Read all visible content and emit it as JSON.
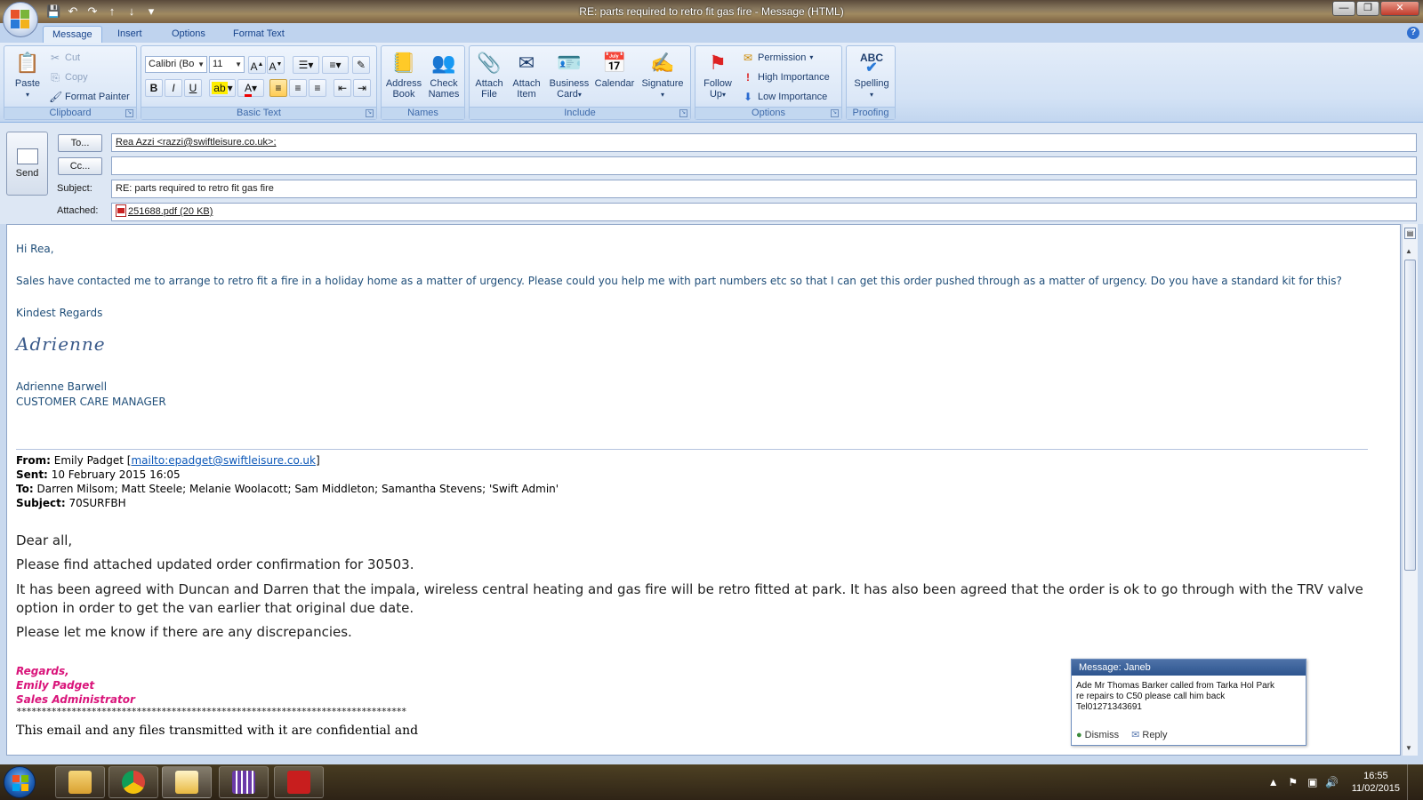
{
  "window": {
    "title": "RE: parts required to retro fit gas fire  - Message (HTML)",
    "controls": {
      "minimize": "—",
      "maximize": "❐",
      "close": "✕"
    }
  },
  "ribbon": {
    "tabs": [
      "Message",
      "Insert",
      "Options",
      "Format Text"
    ],
    "active_tab": "Message",
    "clipboard": {
      "label": "Clipboard",
      "paste": "Paste",
      "cut": "Cut",
      "copy": "Copy",
      "format_painter": "Format Painter"
    },
    "basic_text": {
      "label": "Basic Text",
      "font": "Calibri (Bo",
      "size": "11",
      "bold": "B",
      "italic": "I",
      "underline": "U"
    },
    "names": {
      "label": "Names",
      "address_book_1": "Address",
      "address_book_2": "Book",
      "check_names_1": "Check",
      "check_names_2": "Names"
    },
    "include": {
      "label": "Include",
      "attach_file_1": "Attach",
      "attach_file_2": "File",
      "attach_item_1": "Attach",
      "attach_item_2": "Item",
      "business_card_1": "Business",
      "business_card_2": "Card",
      "calendar": "Calendar",
      "signature": "Signature"
    },
    "options": {
      "label": "Options",
      "follow_up_1": "Follow",
      "follow_up_2": "Up",
      "permission": "Permission",
      "high_importance": "High Importance",
      "low_importance": "Low Importance"
    },
    "proofing": {
      "label": "Proofing",
      "spelling": "Spelling",
      "abc": "ABC"
    }
  },
  "header": {
    "send": "Send",
    "to_button": "To...",
    "cc_button": "Cc...",
    "subject_label": "Subject:",
    "attached_label": "Attached:",
    "to_value": "Rea Azzi <razzi@swiftleisure.co.uk>;",
    "cc_value": "",
    "subject_value": "RE: parts required to retro fit gas fire",
    "attachment": "251688.pdf (20 KB)"
  },
  "body": {
    "greeting": "Hi Rea,",
    "para1": "Sales have contacted me to arrange to retro fit a fire in a holiday home as a matter of urgency.  Please could you help me with part numbers etc so that I can get this order pushed through as a matter of urgency. Do you have a standard kit for this?",
    "closing": "Kindest Regards",
    "signature": "Adrienne",
    "sender_name": "Adrienne Barwell",
    "sender_title": "CUSTOMER CARE MANAGER",
    "quoted": {
      "from_label": "From:",
      "from_value": "Emily Padget [",
      "from_link": "mailto:epadget@swiftleisure.co.uk",
      "from_close": "]",
      "sent_label": "Sent:",
      "sent_value": "10 February 2015 16:05",
      "to_label": "To:",
      "to_value": "Darren Milsom; Matt Steele; Melanie Woolacott; Sam Middleton; Samantha Stevens; 'Swift Admin'",
      "subject_label": "Subject:",
      "subject_value": "70SURFBH",
      "dear": "Dear all,",
      "line1": "Please find attached updated order confirmation for 30503.",
      "line2a": "It has been agreed with Duncan and Darren that the impala, wireless central heating and gas fire will be retro fitted at park. It has also been agreed that the order is ok to go through with the TRV valve",
      "line2b": "option in order to get the van earlier that original due date.",
      "line3": "Please let me know if there are any discrepancies.",
      "regards": "Regards,",
      "name": "Emily Padget",
      "role": "Sales Administrator",
      "stars": "******************************************************************************",
      "disclaimer": "This email and any files transmitted with it are confidential and"
    }
  },
  "notification": {
    "title": "Message: Janeb",
    "line1": "Ade Mr Thomas Barker called  from Tarka Hol Park",
    "line2": "re repairs to C50 please call him back",
    "line3": "Tel01271343691",
    "dismiss": "Dismiss",
    "reply": "Reply"
  },
  "taskbar": {
    "time": "16:55",
    "date": "11/02/2015"
  },
  "colors": {
    "accent": "#15428b",
    "body_text": "#1f4e79",
    "pink": "#d9147a"
  }
}
